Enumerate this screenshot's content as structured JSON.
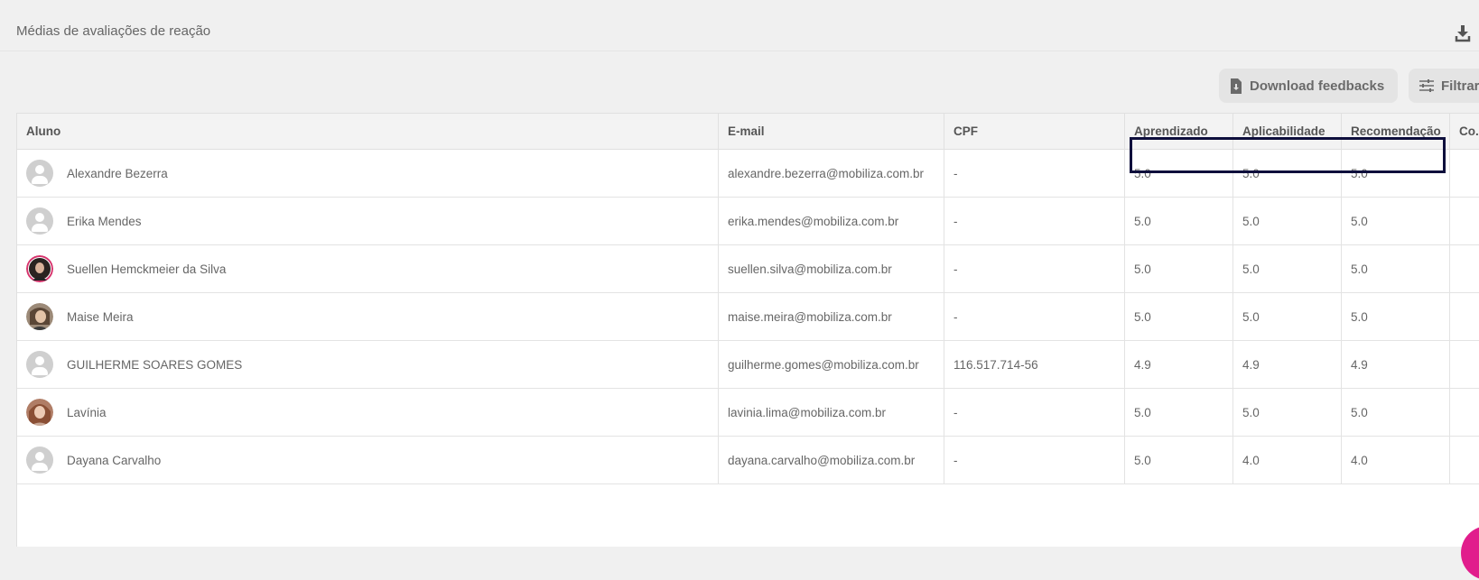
{
  "page": {
    "title": "Médias de avaliações de reação"
  },
  "toolbar": {
    "download_feedbacks_label": "Download feedbacks",
    "filter_label": "Filtrar"
  },
  "icons": {
    "export": "download-icon",
    "download_file": "file-download-icon",
    "filter": "sliders-icon",
    "default_avatar": "user-avatar-icon"
  },
  "colors": {
    "highlight_border": "#0e0f3c",
    "fab": "#e11d8c",
    "avatar_default": "#cfcfcf"
  },
  "table": {
    "columns": {
      "aluno": "Aluno",
      "email": "E-mail",
      "cpf": "CPF",
      "aprendizado": "Aprendizado",
      "aplicabilidade": "Aplicabilidade",
      "recomendacao": "Recomendação",
      "co": "Co.."
    },
    "rows": [
      {
        "name": "Alexandre Bezerra",
        "email": "alexandre.bezerra@mobiliza.com.br",
        "cpf": "-",
        "aprendizado": "5.0",
        "aplicabilidade": "5.0",
        "recomendacao": "5.0"
      },
      {
        "name": "Erika Mendes",
        "email": "erika.mendes@mobiliza.com.br",
        "cpf": "-",
        "aprendizado": "5.0",
        "aplicabilidade": "5.0",
        "recomendacao": "5.0"
      },
      {
        "name": "Suellen Hemckmeier da Silva",
        "email": "suellen.silva@mobiliza.com.br",
        "cpf": "-",
        "aprendizado": "5.0",
        "aplicabilidade": "5.0",
        "recomendacao": "5.0"
      },
      {
        "name": "Maise Meira",
        "email": "maise.meira@mobiliza.com.br",
        "cpf": "-",
        "aprendizado": "5.0",
        "aplicabilidade": "5.0",
        "recomendacao": "5.0"
      },
      {
        "name": "GUILHERME SOARES GOMES",
        "email": "guilherme.gomes@mobiliza.com.br",
        "cpf": "116.517.714-56",
        "aprendizado": "4.9",
        "aplicabilidade": "4.9",
        "recomendacao": "4.9"
      },
      {
        "name": "Lavínia",
        "email": "lavinia.lima@mobiliza.com.br",
        "cpf": "-",
        "aprendizado": "5.0",
        "aplicabilidade": "5.0",
        "recomendacao": "5.0"
      },
      {
        "name": "Dayana Carvalho",
        "email": "dayana.carvalho@mobiliza.com.br",
        "cpf": "-",
        "aprendizado": "5.0",
        "aplicabilidade": "4.0",
        "recomendacao": "4.0"
      }
    ]
  }
}
